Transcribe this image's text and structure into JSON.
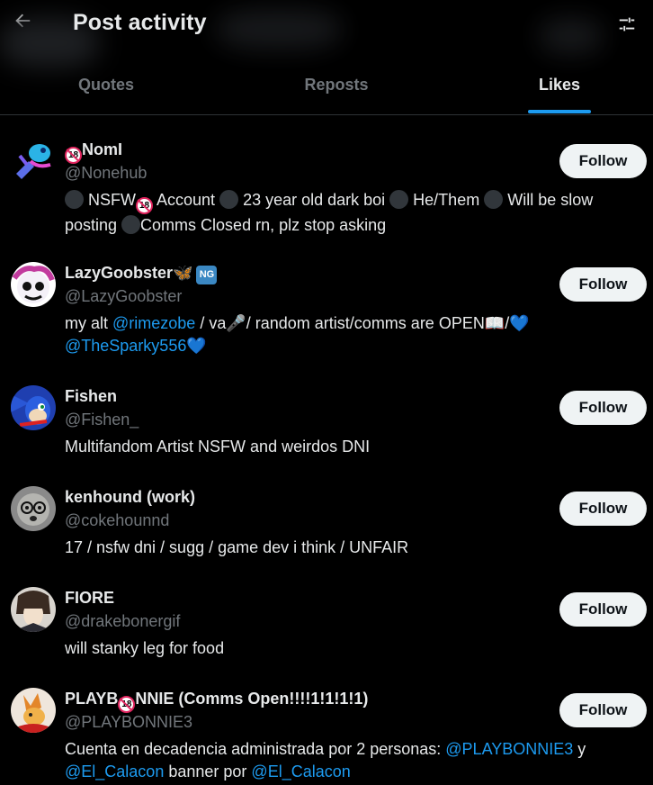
{
  "header": {
    "title": "Post activity",
    "back_icon": "arrow-left-icon",
    "settings_icon": "sliders-icon"
  },
  "tabs": [
    {
      "label": "Quotes",
      "active": false
    },
    {
      "label": "Reposts",
      "active": false
    },
    {
      "label": "Likes",
      "active": true
    }
  ],
  "colors": {
    "background": "#000000",
    "accent": "#1d9bf0",
    "muted": "#71767b",
    "text": "#e7e9ea",
    "follow_button_bg": "#eff3f4"
  },
  "users": [
    {
      "name_prefix_icon": "18-prohibited",
      "name": "NomI",
      "handle": "@Nonehub",
      "bio_parts": [
        {
          "dot": true
        },
        {
          "text": " NSFW"
        },
        {
          "emoji18": true
        },
        {
          "text": " Account "
        },
        {
          "dot": true
        },
        {
          "text": " 23 year old dark boi "
        },
        {
          "dot": true
        },
        {
          "text": " He/Them "
        },
        {
          "dot": true
        },
        {
          "text": " Will be slow posting "
        },
        {
          "dot": true
        },
        {
          "text": "Comms Closed rn, plz stop asking"
        }
      ],
      "follow_label": "Follow"
    },
    {
      "name": "LazyGoobster",
      "name_suffix_icons": [
        "butterfly-emoji",
        "ng-badge"
      ],
      "ng_text": "NG",
      "handle": "@LazyGoobster",
      "bio_parts": [
        {
          "text": "my alt "
        },
        {
          "link": "@rimezobe"
        },
        {
          "text": " / va"
        },
        {
          "text": "🎤"
        },
        {
          "text": "/ random artist/comms are OPEN"
        },
        {
          "text": "📖"
        },
        {
          "text": "/"
        },
        {
          "heart": "💙"
        },
        {
          "text": " "
        },
        {
          "link": "@TheSparky556"
        },
        {
          "heart": "💙"
        }
      ],
      "follow_label": "Follow"
    },
    {
      "name": "Fishen",
      "handle": "@Fishen_",
      "bio_parts": [
        {
          "text": "Multifandom Artist NSFW and weirdos DNI"
        }
      ],
      "follow_label": "Follow"
    },
    {
      "name": "kenhound (work)",
      "handle": "@cokehounnd",
      "bio_parts": [
        {
          "text": "17 / nsfw dni / sugg / game dev i think / UNFAIR"
        }
      ],
      "follow_label": "Follow"
    },
    {
      "name": "FIORE",
      "handle": "@drakebonergif",
      "bio_parts": [
        {
          "text": "will stanky leg for food"
        }
      ],
      "follow_label": "Follow"
    },
    {
      "name_pre": "PLAYB",
      "name_post": "NNIE (Comms Open!!!!1!1!1!1)",
      "handle": "@PLAYBONNIE3",
      "bio_parts": [
        {
          "text": "Cuenta en decadencia administrada por 2 personas: "
        },
        {
          "link": "@PLAYBONNIE3"
        },
        {
          "text": " y "
        },
        {
          "link": "@El_Calacon"
        },
        {
          "text": " banner por "
        },
        {
          "link": "@El_Calacon"
        }
      ],
      "follow_label": "Follow"
    }
  ]
}
